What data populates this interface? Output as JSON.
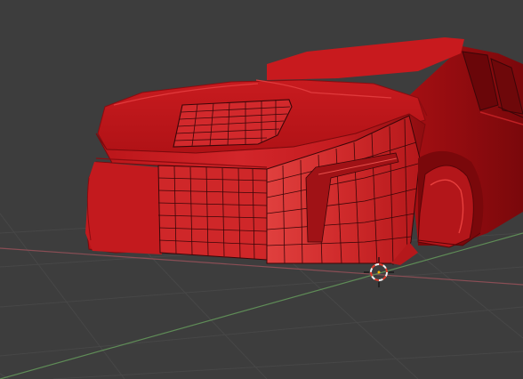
{
  "viewport": {
    "mode": "3d-viewport",
    "shading": "solid",
    "overlays": [
      "grid-floor",
      "x-axis",
      "y-axis",
      "3d-cursor",
      "wireframe-mesh"
    ],
    "colors": {
      "background": "#3d3d3d",
      "grid_line": "#4a4a4a",
      "x_axis": "#8a4e55",
      "y_axis": "#5f8c57",
      "mesh_fill": "#c8181c",
      "mesh_highlight": "#e83a3a",
      "mesh_shadow": "#7a0a0d",
      "wire": "#3a0608",
      "cursor_ring_red": "#e03a2a",
      "cursor_ring_white": "#f2f2f2"
    },
    "object": {
      "name_shown": "",
      "type": "car-body-mesh"
    }
  }
}
